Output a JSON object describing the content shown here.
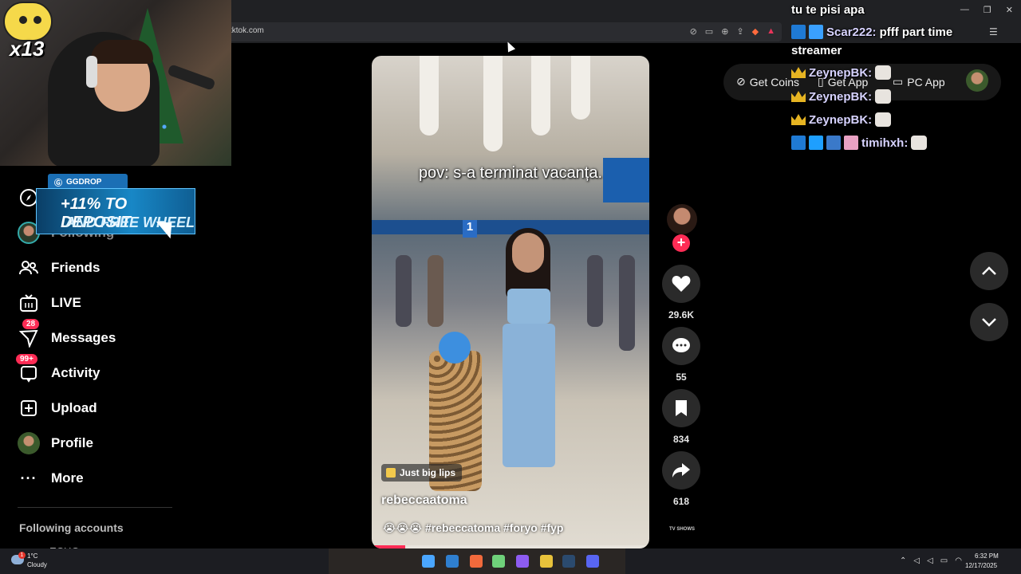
{
  "browser": {
    "url": "tktok.com",
    "window_title": "tu te pisi apa"
  },
  "sidebar": {
    "items": [
      {
        "label": "",
        "icon": "compass-icon",
        "badge": ""
      },
      {
        "label": "Following",
        "icon": "following-avatar-icon",
        "badge": ""
      },
      {
        "label": "Friends",
        "icon": "friends-icon",
        "badge": ""
      },
      {
        "label": "LIVE",
        "icon": "live-tv-icon",
        "badge": ""
      },
      {
        "label": "Messages",
        "icon": "messages-icon",
        "badge": "28"
      },
      {
        "label": "Activity",
        "icon": "activity-icon",
        "badge": "99+"
      },
      {
        "label": "Upload",
        "icon": "upload-icon",
        "badge": ""
      },
      {
        "label": "Profile",
        "icon": "profile-avatar-icon",
        "badge": ""
      },
      {
        "label": "More",
        "icon": "more-dots-icon",
        "badge": ""
      }
    ],
    "following_accounts_title": "Following accounts",
    "following_account_cut": "ECHO"
  },
  "webcam": {
    "multiplier": "x13"
  },
  "ad": {
    "brand": "GGDROP",
    "line1": "+11% TO DEPOSIT",
    "line2": "AND FREE WHEEL"
  },
  "video": {
    "caption": "pov: s-a terminat vacanța.",
    "sound": "Just big lips",
    "author": "rebeccaatoma",
    "description": "😭😭😭 #rebeccatoma #foryo #fyp",
    "gate_number": "1",
    "progress": 0.12
  },
  "actions": {
    "likes": "29.6K",
    "comments": "55",
    "saves": "834",
    "shares": "618",
    "tv_shows": "TV SHOWS"
  },
  "top_bar": {
    "get_coins": "Get Coins",
    "get_app": "Get App",
    "pc_app": "PC App"
  },
  "chat": {
    "title": "tu te pisi apa",
    "messages": [
      {
        "user": "Scar222:",
        "text": "pfff part time"
      },
      {
        "user": "",
        "text": "streamer"
      },
      {
        "user": "ZeynepBK:",
        "text": ""
      },
      {
        "user": "ZeynepBK:",
        "text": ""
      },
      {
        "user": "ZeynepBK:",
        "text": ""
      },
      {
        "user": "timihxh:",
        "text": ""
      }
    ]
  },
  "taskbar": {
    "weather_badge": "1",
    "temperature": "1°C",
    "weather": "Cloudy",
    "time": "6:32 PM",
    "date": "12/17/2025"
  },
  "colors": {
    "accent": "#fe2c55",
    "chat_name": "#d7d3ff",
    "ad_blue": "#1887c6"
  }
}
